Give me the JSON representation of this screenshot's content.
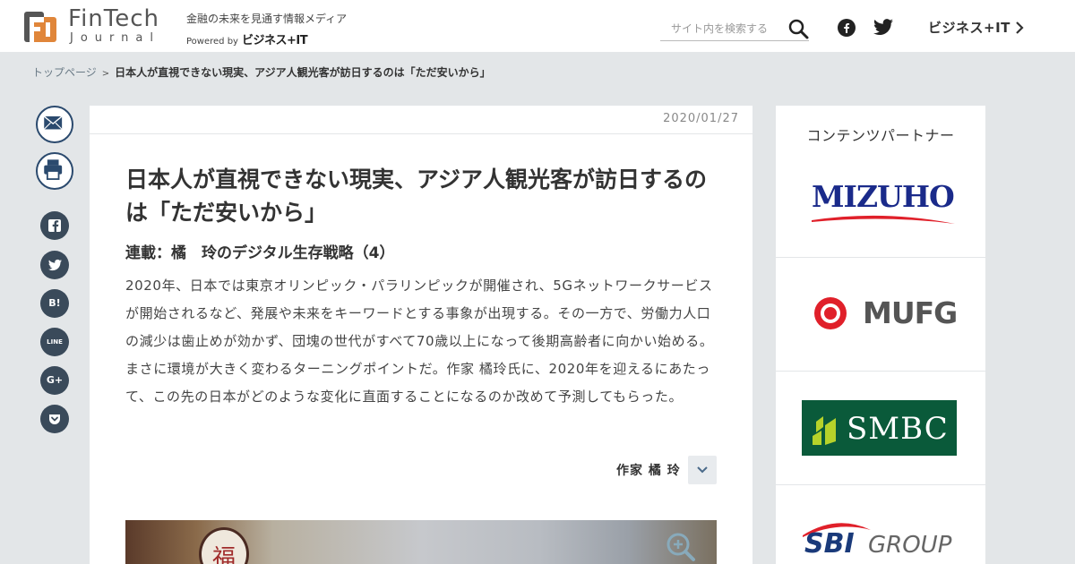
{
  "header": {
    "logo_name": "FinTech",
    "logo_sub": "Journal",
    "tagline": "金融の未来を見通す情報メディア",
    "powered_label": "Powered by",
    "powered_brand": "ビジネス+IT",
    "search_placeholder": "サイト内を検索する",
    "biz_link": "ビジネス+IT",
    "brand_colors": {
      "logo_orange": "#e0863a",
      "logo_gray": "#555555"
    }
  },
  "breadcrumb": {
    "home": "トップページ",
    "separator": ">",
    "current": "日本人が直視できない現実、アジア人観光客が訪日するのは「ただ安いから」"
  },
  "share": {
    "icons": [
      "mail-icon",
      "print-icon",
      "facebook-icon",
      "twitter-icon",
      "hatena-bookmark-icon",
      "line-icon",
      "google-plus-icon",
      "pocket-icon"
    ],
    "hatena_label": "B!",
    "line_label": "LINE",
    "gplus_label": "G+"
  },
  "article": {
    "date": "2020/01/27",
    "title": "日本人が直視できない現実、アジア人観光客が訪日するのは「ただ安いから」",
    "subtitle": "連載：橘　玲のデジタル生存戦略（4）",
    "lead": "2020年、日本では東京オリンピック・パラリンピックが開催され、5Gネットワークサービスが開始されるなど、発展や未来をキーワードとする事象が出現する。その一方で、労働力人口の減少は歯止めが効かず、団塊の世代がすべて70歳以上になって後期高齢者に向かい始める。まさに環境が大きく変わるターニングポイントだ。作家 橘玲氏に、2020年を迎えるにあたって、この先の日本がどのような変化に直面することになるのか改めて予測してもらった。",
    "author": "作家 橘 玲",
    "hero_sign_char": "福"
  },
  "partners": {
    "title": "コンテンツパートナー",
    "mizuho": "MIZUHO",
    "mufg": "MUFG",
    "smbc": "SMBC",
    "sbi": "SBI",
    "group": "GROUP"
  }
}
